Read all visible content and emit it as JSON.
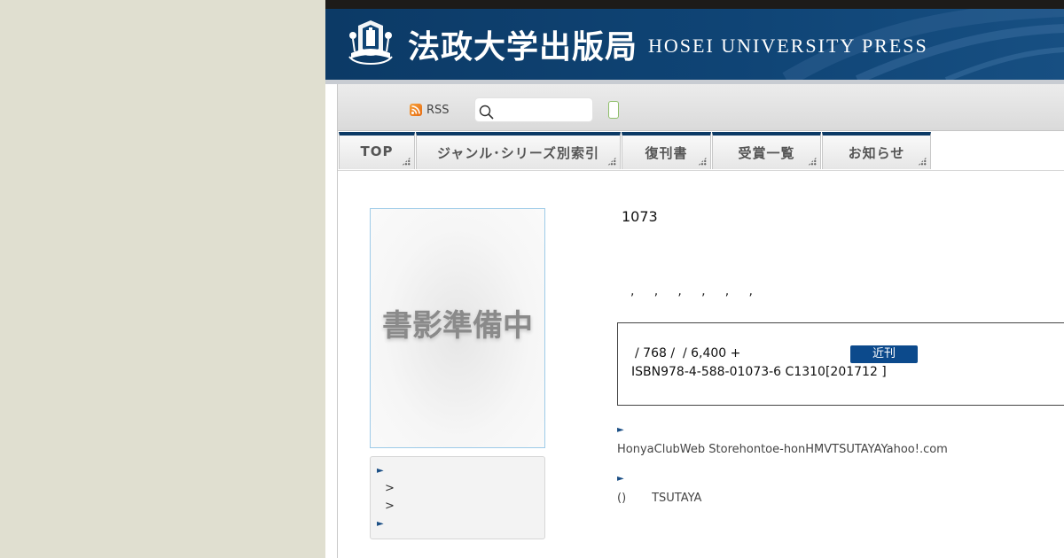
{
  "header": {
    "title_jp": "法政大学出版局",
    "title_en": "HOSEI UNIVERSITY PRESS",
    "logo_icon": "hosei-press-logo",
    "logo_motto_text": "HOSEI UNIVERSITY PRESS",
    "colors": {
      "banner": "#0c3a66",
      "topbar": "#1d1b19"
    }
  },
  "toolbar": {
    "rss_label": "RSS",
    "rss_icon": "rss-icon",
    "search": {
      "value": "",
      "placeholder": "",
      "icon": "search-icon"
    }
  },
  "nav": {
    "tabs": [
      {
        "label": "TOP"
      },
      {
        "label": "ジャンル･シリーズ別索引"
      },
      {
        "label": "復刊書"
      },
      {
        "label": "受賞一覧"
      },
      {
        "label": "お知らせ"
      }
    ],
    "accent_color": "#0c3a66"
  },
  "cover": {
    "placeholder_text": "書影準備中"
  },
  "sidebar": {
    "lines": [
      ">",
      ">"
    ]
  },
  "book": {
    "number": "1073",
    "contributors_line": ",     ,     ,     ,     ,     ,",
    "spec_line": "/ 768 /  / 6,400 +",
    "isbn_line": "ISBN978-4-588-01073-6 C1310[201712 ]",
    "status_badge": "近刊",
    "badge_color": "#0c4a8c"
  },
  "retail": {
    "online_stores": "HonyaClubWeb Storehontoe-honHMVTSUTAYAYahoo!.com",
    "physical_stores": "()       TSUTAYA"
  }
}
